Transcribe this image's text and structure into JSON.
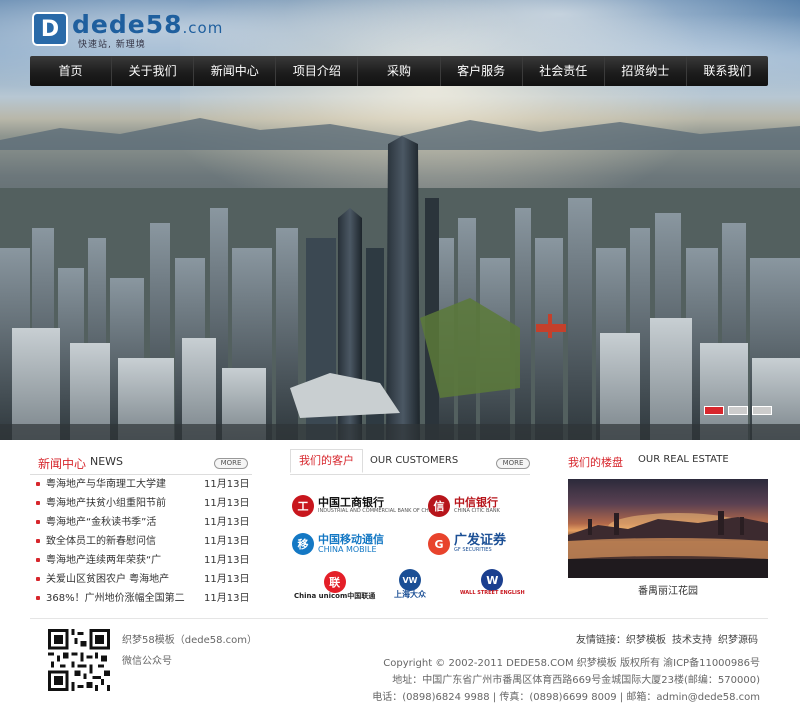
{
  "logo": {
    "mark": "D",
    "brand": "dede58",
    "tld": ".com",
    "slogan": "快速站, 新理境"
  },
  "nav": [
    "首页",
    "关于我们",
    "新闻中心",
    "项目介绍",
    "采购",
    "客户服务",
    "社会责任",
    "招贤纳士",
    "联系我们"
  ],
  "hero": {
    "slider_active": 1,
    "slider_count": 3,
    "alt": "城市航拍"
  },
  "news": {
    "title_cn": "新闻中心",
    "title_en": "NEWS",
    "more": "MORE",
    "items": [
      {
        "title": "粤海地产与华南理工大学建",
        "date": "11月13日"
      },
      {
        "title": "粤海地产扶贫小组重阳节前",
        "date": "11月13日"
      },
      {
        "title": "粤海地产“金秋读书季”活",
        "date": "11月13日"
      },
      {
        "title": "致全体员工的新春慰问信",
        "date": "11月13日"
      },
      {
        "title": "粤海地产连续两年荣获“广",
        "date": "11月13日"
      },
      {
        "title": "关爱山区贫困农户 粤海地产",
        "date": "11月13日"
      },
      {
        "title": "368%！广州地价涨幅全国第二",
        "date": "11月13日"
      }
    ]
  },
  "clients": {
    "title_cn": "我们的客户",
    "title_en": "OUR CUSTOMERS",
    "more": "MORE",
    "logos": [
      {
        "name": "中国工商银行",
        "sub": "INDUSTRIAL AND COMMERCIAL BANK OF CHINA",
        "icon": "工",
        "color": "#c8161d"
      },
      {
        "name": "中信银行",
        "sub": "CHINA CITIC BANK",
        "icon": "信",
        "color": "#b7151b"
      },
      {
        "name": "中国移动通信",
        "sub": "CHINA MOBILE",
        "icon": "移",
        "color": "#1478c4"
      },
      {
        "name": "广发证券",
        "sub": "GF SECURITIES",
        "icon": "G",
        "color": "#e8432c"
      },
      {
        "name": "China unicom中国联通",
        "sub": "",
        "icon": "联",
        "color": "#e41f28"
      },
      {
        "name": "上海大众",
        "sub": "",
        "icon": "VW",
        "color": "#1b4f95"
      },
      {
        "name": "WALL STREET ENGLISH",
        "sub": "",
        "icon": "W",
        "color": "#1b3f8f"
      }
    ]
  },
  "estate": {
    "title_cn": "我们的楼盘",
    "title_en": "OUR REAL ESTATE",
    "caption": "番禺丽江花园"
  },
  "footer": {
    "qr_label": "织梦58模板（dede58.com）",
    "wechat": "微信公众号",
    "links_label": "友情链接：",
    "links": [
      "织梦模板",
      "技术支持",
      "织梦源码"
    ],
    "copyright": "Copyright © 2002-2011 DEDE58.COM 织梦模板 版权所有 渝ICP备11000986号",
    "address": "地址：中国广东省广州市番禺区体育西路669号金城国际大厦23楼(邮编：570000)",
    "contact": "电话：(0898)6824 9988 | 传真：(0898)6699 8009 | 邮箱：admin@dede58.com"
  }
}
